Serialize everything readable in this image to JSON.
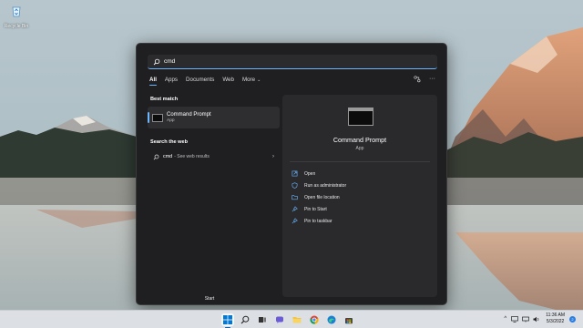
{
  "desktop": {
    "recycle_bin_label": "Recycle Bin"
  },
  "search": {
    "value": "cmd",
    "icon": "search-icon"
  },
  "tabs": [
    {
      "label": "All",
      "active": true
    },
    {
      "label": "Apps"
    },
    {
      "label": "Documents"
    },
    {
      "label": "Web"
    },
    {
      "label": "More"
    }
  ],
  "header_icons": [
    "share-icon",
    "more-options-icon"
  ],
  "header_more_glyph": "···",
  "best_match": {
    "heading": "Best match",
    "title": "Command Prompt",
    "subtitle": "App"
  },
  "web_section": {
    "heading": "Search the web",
    "query": "cmd",
    "suffix": "- See web results"
  },
  "detail": {
    "title": "Command Prompt",
    "subtitle": "App",
    "actions": [
      {
        "label": "Open",
        "icon": "open-icon"
      },
      {
        "label": "Run as administrator",
        "icon": "shield-icon"
      },
      {
        "label": "Open file location",
        "icon": "folder-icon"
      },
      {
        "label": "Pin to Start",
        "icon": "pin-icon"
      },
      {
        "label": "Pin to taskbar",
        "icon": "pin-icon"
      }
    ]
  },
  "start_footer": "Start",
  "taskbar": {
    "apps": [
      "windows-start-icon",
      "search-icon",
      "task-view-icon",
      "chat-icon",
      "file-explorer-icon",
      "chrome-icon",
      "edge-icon",
      "store-icon"
    ],
    "tray_chevron": "^",
    "time": "11:36 AM",
    "date": "5/3/2022",
    "notification_count": "2"
  },
  "colors": {
    "accent": "#6cb6ff",
    "menu_bg": "#1f1f21",
    "pane_bg": "#2a2a2d",
    "taskbar_bg": "#dcdfe4"
  }
}
